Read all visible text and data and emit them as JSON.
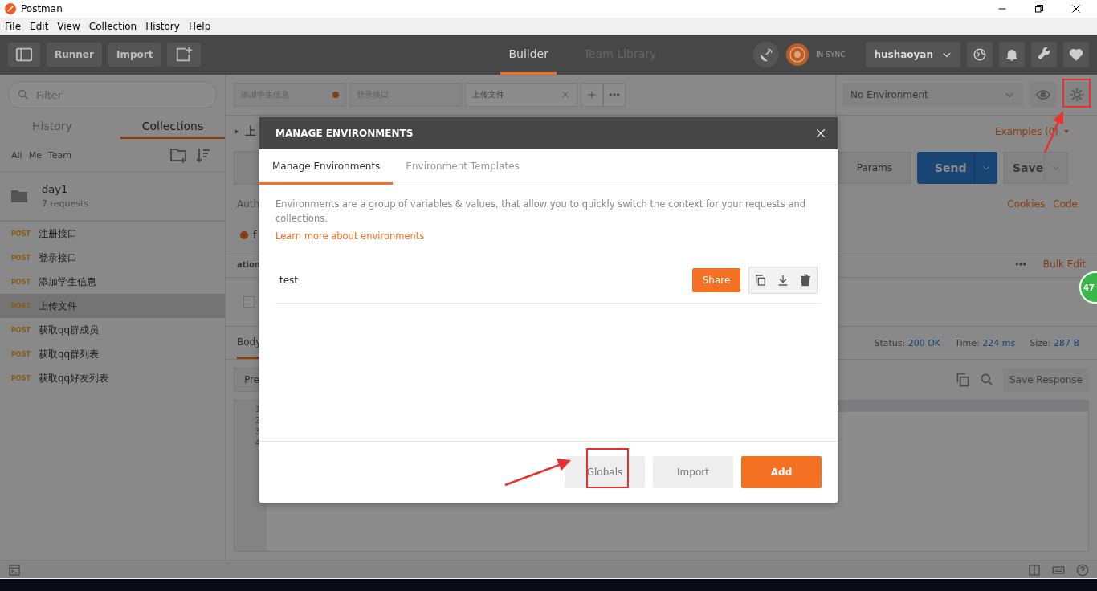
{
  "window": {
    "title": "Postman"
  },
  "menu": [
    "File",
    "Edit",
    "View",
    "Collection",
    "History",
    "Help"
  ],
  "header": {
    "buttons": [
      "Runner",
      "Import"
    ],
    "tabs": [
      {
        "label": "Builder",
        "selected": true
      },
      {
        "label": "Team Library",
        "selected": false
      }
    ],
    "sync": "IN SYNC",
    "user": "hushaoyan"
  },
  "sidebar": {
    "search": {
      "placeholder": "Filter"
    },
    "tabs": [
      {
        "label": "History",
        "selected": false
      },
      {
        "label": "Collections",
        "selected": true
      }
    ],
    "filters": [
      "All",
      "Me",
      "Team"
    ],
    "collection": {
      "name": "day1",
      "count": "7 requests"
    },
    "requests": [
      {
        "method": "POST",
        "name": "注册接口",
        "selected": false
      },
      {
        "method": "POST",
        "name": "登录接口",
        "selected": false
      },
      {
        "method": "POST",
        "name": "添加学生信息",
        "selected": false
      },
      {
        "method": "POST",
        "name": "上传文件",
        "selected": true
      },
      {
        "method": "POST",
        "name": "获取qq群成员",
        "selected": false
      },
      {
        "method": "POST",
        "name": "获取qq群列表",
        "selected": false
      },
      {
        "method": "POST",
        "name": "获取qq好友列表",
        "selected": false
      }
    ]
  },
  "request_tabs": [
    {
      "label": "添加学生信息",
      "unsaved": true,
      "selected": false
    },
    {
      "label": "登录接口",
      "unsaved": false,
      "selected": false
    },
    {
      "label": "上传文件",
      "unsaved": false,
      "selected": true
    }
  ],
  "environment": {
    "selected": "No Environment"
  },
  "request": {
    "name": "上",
    "examples": "Examples (0)",
    "params": "Params",
    "send": "Send",
    "save": "Save",
    "auth": "Auth",
    "links": [
      "Cookies",
      "Code"
    ],
    "body_option": {
      "label": "f",
      "selected": true
    },
    "row_checked": false,
    "table_header": "ation",
    "bulk_edit": "Bulk Edit"
  },
  "response": {
    "tab": "Body",
    "status_label": "Status:",
    "status": "200 OK",
    "time_label": "Time:",
    "time": "224 ms",
    "size_label": "Size:",
    "size": "287 B",
    "format": "Pre",
    "save": "Save Response",
    "line_numbers": [
      "1",
      "2",
      "3",
      "4"
    ]
  },
  "badge": "47",
  "modal": {
    "title": "MANAGE ENVIRONMENTS",
    "tabs": [
      {
        "label": "Manage Environments",
        "selected": true
      },
      {
        "label": "Environment Templates",
        "selected": false
      }
    ],
    "description": "Environments are a group of variables & values, that allow you to quickly switch the context for your requests and collections.",
    "link": "Learn more about environments",
    "environments": [
      {
        "name": "test",
        "share": "Share"
      }
    ],
    "buttons": [
      {
        "label": "Globals",
        "kind": "secondary"
      },
      {
        "label": "Import",
        "kind": "secondary"
      },
      {
        "label": "Add",
        "kind": "primary"
      }
    ]
  }
}
